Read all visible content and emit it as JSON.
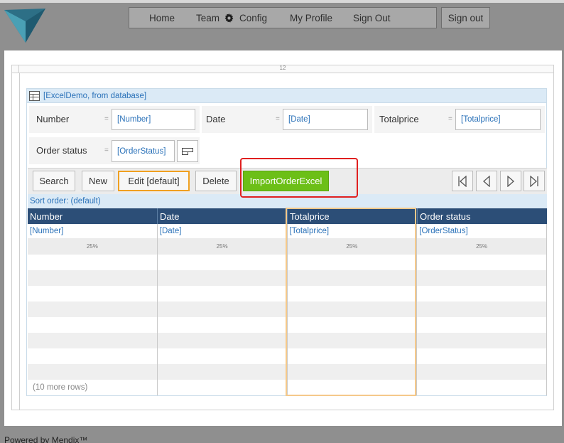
{
  "nav": {
    "home": "Home",
    "team": "Team",
    "config": "Config",
    "my_profile": "My Profile",
    "sign_out_link": "Sign Out"
  },
  "signout_button": "Sign out",
  "ruler_label": "12",
  "dataview": {
    "header": "[ExcelDemo, from database]",
    "fields": {
      "number": {
        "label": "Number",
        "value": "[Number]"
      },
      "date": {
        "label": "Date",
        "value": "[Date]"
      },
      "totalprice": {
        "label": "Totalprice",
        "value": "[Totalprice]"
      },
      "order_status": {
        "label": "Order status",
        "value": "[OrderStatus]"
      }
    },
    "eq": "="
  },
  "toolbar": {
    "search": "Search",
    "new": "New",
    "edit": "Edit [default]",
    "delete": "Delete",
    "import": "ImportOrderExcel"
  },
  "sort_order": "Sort order: (default)",
  "grid": {
    "columns": [
      "Number",
      "Date",
      "Totalprice",
      "Order status"
    ],
    "attributes": [
      "[Number]",
      "[Date]",
      "[Totalprice]",
      "[OrderStatus]"
    ],
    "widths": [
      "25%",
      "25%",
      "25%",
      "25%"
    ],
    "more_rows": "(10 more rows)"
  },
  "watermark": "Mendix",
  "footer": "Powered by Mendix™",
  "colors": {
    "header_blue": "#2c4e77",
    "accent_green": "#6cbf17",
    "link_blue": "#2b72b9",
    "highlight_red": "#e02020",
    "highlight_orange": "#f0a020"
  }
}
